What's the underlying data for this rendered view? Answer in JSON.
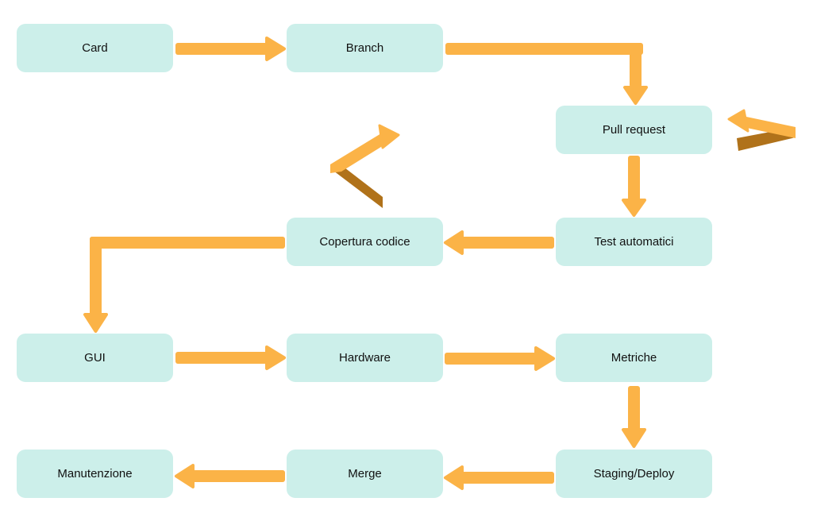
{
  "diagram": {
    "type": "flowchart",
    "colors": {
      "node_fill": "#ccefea",
      "node_text": "#111111",
      "arrow": "#fbb347",
      "arrow_shadow": "#b0721a",
      "background": "#ffffff"
    },
    "nodes": [
      {
        "id": "card",
        "label": "Card"
      },
      {
        "id": "branch",
        "label": "Branch"
      },
      {
        "id": "pull-request",
        "label": "Pull request"
      },
      {
        "id": "test-automatici",
        "label": "Test automatici"
      },
      {
        "id": "copertura-codice",
        "label": "Copertura codice"
      },
      {
        "id": "gui",
        "label": "GUI"
      },
      {
        "id": "hardware",
        "label": "Hardware"
      },
      {
        "id": "metriche",
        "label": "Metriche"
      },
      {
        "id": "staging-deploy",
        "label": "Staging/Deploy"
      },
      {
        "id": "merge",
        "label": "Merge"
      },
      {
        "id": "manutenzione",
        "label": "Manutenzione"
      }
    ],
    "edges": [
      {
        "from": "card",
        "to": "branch"
      },
      {
        "from": "branch",
        "to": "pull-request"
      },
      {
        "from": "pull-request",
        "to": "test-automatici"
      },
      {
        "from": "test-automatici",
        "to": "copertura-codice"
      },
      {
        "from": "copertura-codice",
        "to": "gui"
      },
      {
        "from": "gui",
        "to": "hardware"
      },
      {
        "from": "hardware",
        "to": "metriche"
      },
      {
        "from": "metriche",
        "to": "staging-deploy"
      },
      {
        "from": "staging-deploy",
        "to": "merge"
      },
      {
        "from": "merge",
        "to": "manutenzione"
      }
    ],
    "loop_arrows": [
      {
        "near": "pull-request",
        "direction": "back-left"
      },
      {
        "near": "copertura-codice",
        "direction": "back-up-right"
      }
    ]
  }
}
